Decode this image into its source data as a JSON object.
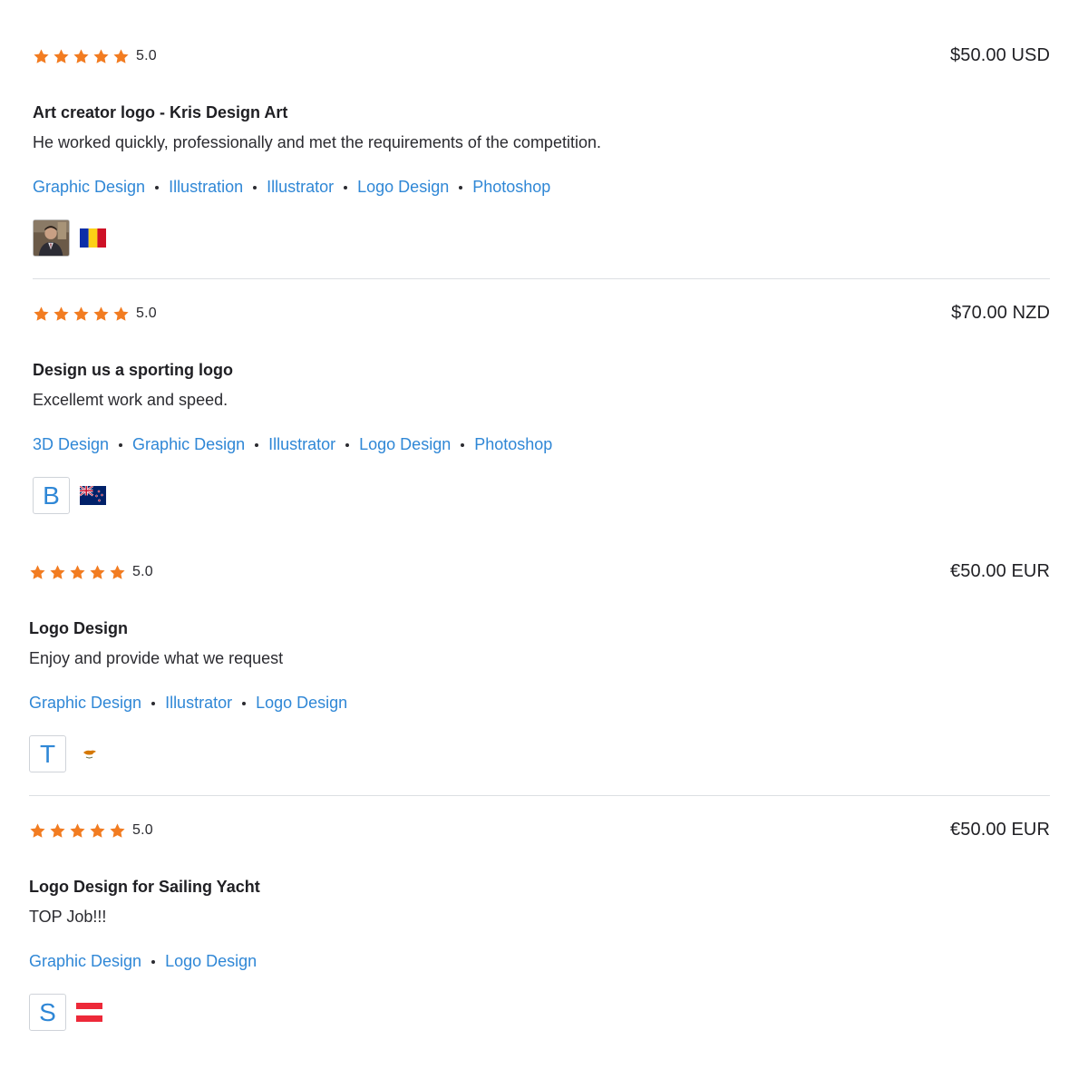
{
  "colors": {
    "star": "#f27c21",
    "link": "#2f87d6",
    "text": "#1f1f23",
    "divider": "#dcdfe3"
  },
  "reviews": [
    {
      "rating": 5,
      "score": "5.0",
      "price": "$50.00 USD",
      "title": "Art creator logo - Kris Design Art",
      "comment": "He worked quickly, professionally and met the requirements of the competition.",
      "skills": [
        "Graphic Design",
        "Illustration",
        "Illustrator",
        "Logo Design",
        "Photoshop"
      ],
      "avatar": {
        "type": "photo",
        "icon": "user-photo"
      },
      "flag": "romania-flag"
    },
    {
      "rating": 5,
      "score": "5.0",
      "price": "$70.00 NZD",
      "title": "Design us a sporting logo",
      "comment": "Excellemt work and speed.",
      "skills": [
        "3D Design",
        "Graphic Design",
        "Illustrator",
        "Logo Design",
        "Photoshop"
      ],
      "avatar": {
        "type": "letter",
        "letter": "B"
      },
      "flag": "new-zealand-flag"
    },
    {
      "rating": 5,
      "score": "5.0",
      "price": "€50.00 EUR",
      "title": "Logo Design",
      "comment": "Enjoy and provide what we request",
      "skills": [
        "Graphic Design",
        "Illustrator",
        "Logo Design"
      ],
      "avatar": {
        "type": "letter",
        "letter": "T"
      },
      "flag": "cyprus-flag"
    },
    {
      "rating": 5,
      "score": "5.0",
      "price": "€50.00 EUR",
      "title": "Logo Design for Sailing Yacht",
      "comment": "TOP Job!!!",
      "skills": [
        "Graphic Design",
        "Logo Design"
      ],
      "avatar": {
        "type": "letter",
        "letter": "S"
      },
      "flag": "austria-flag"
    }
  ]
}
